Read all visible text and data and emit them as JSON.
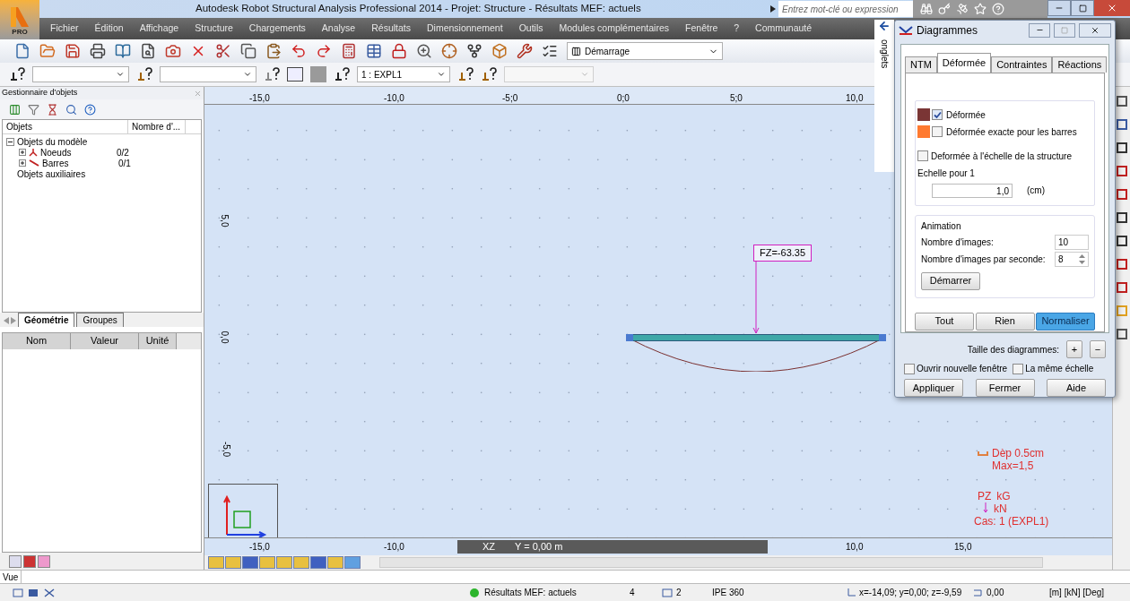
{
  "title_bar": {
    "logo_label": "PRO",
    "title": "Autodesk Robot Structural Analysis Professional 2014 - Projet: Structure - Résultats MEF: actuels",
    "search": {
      "placeholder": "Entrez mot-clé ou expression"
    }
  },
  "menu": [
    "Fichier",
    "Édition",
    "Affichage",
    "Structure",
    "Chargements",
    "Analyse",
    "Résultats",
    "Dimensionnement",
    "Outils",
    "Modules complémentaires",
    "Fenêtre",
    "?",
    "Communauté"
  ],
  "toolbar": {
    "layout_combo": "Démarrage",
    "case_combo": "1 : EXPL1"
  },
  "object_manager": {
    "title": "Gestionnaire d'objets",
    "columns": [
      "Objets",
      "Nombre d'..."
    ],
    "tree": [
      {
        "label": "Objets du modèle",
        "expanded": true,
        "children": [
          {
            "label": "Noeuds",
            "count": "0/2",
            "expanded": false,
            "kind": "node"
          },
          {
            "label": "Barres",
            "count": "0/1",
            "expanded": false,
            "kind": "bar"
          }
        ]
      },
      {
        "label": "Objets auxiliaires"
      }
    ],
    "tabs": [
      {
        "label": "Géométrie",
        "selected": true
      },
      {
        "label": "Groupes",
        "selected": false
      }
    ],
    "property_columns": [
      "Nom",
      "Valeur",
      "Unité"
    ]
  },
  "canvas": {
    "x_ticks": [
      "-15,0",
      "-10,0",
      "-5;0",
      "0;0",
      "5;0",
      "10,0"
    ],
    "y_ticks": [
      "5,0",
      "0,0",
      "-5,0"
    ],
    "bottom_ticks": [
      "-15,0",
      "-10,0",
      "10,0",
      "15,0"
    ],
    "view_plane": "XZ",
    "view_position": "Y = 0,00 m",
    "force_label": "FZ=-63.35",
    "legend": {
      "deformation": "Dèp  0.5cm",
      "max": "Max=1,5",
      "force": "PZ",
      "unit_1": "kG",
      "unit_2": "kN",
      "case": "Cas: 1 (EXPL1)"
    }
  },
  "dialog": {
    "title": "Diagrammes",
    "side_label": "onglets",
    "tabs": [
      {
        "label": "NTM",
        "selected": false
      },
      {
        "label": "Déformée",
        "selected": true
      },
      {
        "label": "Contraintes",
        "selected": false
      },
      {
        "label": "Réactions",
        "selected": false
      }
    ],
    "options": [
      {
        "label": "Déformée",
        "checked": true,
        "color": "#7a3535"
      },
      {
        "label": "Déformée exacte pour les barres",
        "checked": false,
        "color": "#ff7a30"
      }
    ],
    "scale_option": {
      "label": "Deformée à l'échelle de la structure",
      "checked": false
    },
    "scale_label": "Echelle pour 1",
    "scale_value": "1,0",
    "scale_unit": "(cm)",
    "animation": {
      "title": "Animation",
      "frames_label": "Nombre d'images:",
      "frames": "10",
      "fps_label": "Nombre d'images par seconde:",
      "fps": "8",
      "start": "Démarrer"
    },
    "select_buttons": [
      {
        "label": "Tout",
        "highlighted": false
      },
      {
        "label": "Rien",
        "highlighted": false
      },
      {
        "label": "Normaliser",
        "highlighted": true
      }
    ],
    "size_label": "Taille des diagrammes:",
    "size_buttons": [
      "+",
      "−"
    ],
    "bottom_options": [
      {
        "label": "Ouvrir nouvelle fenêtre",
        "checked": false
      },
      {
        "label": "La même échelle",
        "checked": false
      }
    ],
    "actions": [
      "Appliquer",
      "Fermer",
      "Aide"
    ]
  },
  "view_tab": "Vue",
  "status_bar": {
    "results": "Résultats MEF: actuels",
    "field_1": "4",
    "field_2": "2",
    "section": "IPE 360",
    "coordinates": "x=-14,09; y=0,00; z=-9,59",
    "value": "0,00",
    "units": "[m] [kN] [Deg]"
  }
}
